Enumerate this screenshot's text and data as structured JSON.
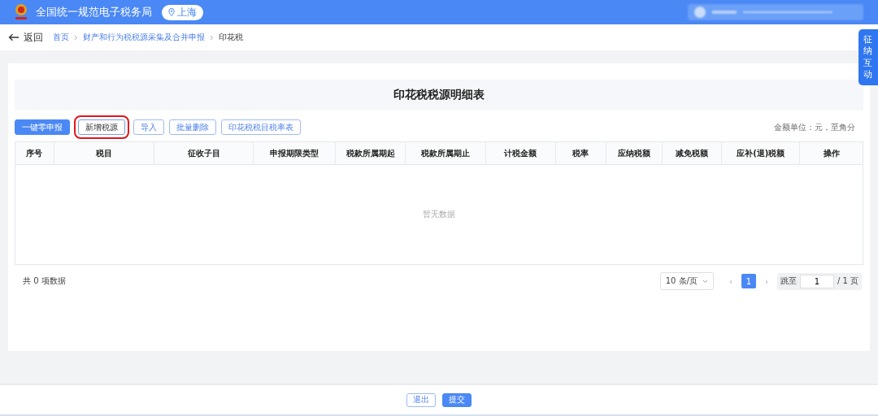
{
  "header": {
    "title": "全国统一规范电子税务局",
    "region": "上海"
  },
  "side_tab": {
    "label": "征纳互动"
  },
  "nav": {
    "back": "返回",
    "breadcrumb": [
      {
        "label": "首页",
        "link": true
      },
      {
        "label": "财产和行为税税源采集及合并申报",
        "link": true
      },
      {
        "label": "印花税",
        "link": false
      }
    ]
  },
  "page_title": "印花税税源明细表",
  "toolbar": [
    {
      "label": "一键零申报",
      "kind": "primary",
      "highlighted": false
    },
    {
      "label": "新增税源",
      "kind": "outline",
      "highlighted": true
    },
    {
      "label": "导入",
      "kind": "outline",
      "highlighted": false
    },
    {
      "label": "批量删除",
      "kind": "outline",
      "highlighted": false
    },
    {
      "label": "印花税税目税率表",
      "kind": "outline",
      "highlighted": false
    }
  ],
  "unit_note": "金额单位：元，至角分",
  "table": {
    "columns": [
      {
        "label": "序号"
      },
      {
        "label": "税目"
      },
      {
        "label": "征收子目"
      },
      {
        "label": "申报期限类型"
      },
      {
        "label": "税款所属期起"
      },
      {
        "label": "税款所属期止"
      },
      {
        "label": "计税金额"
      },
      {
        "label": "税率"
      },
      {
        "label": "应纳税额"
      },
      {
        "label": "减免税额"
      },
      {
        "label": "应补(退)税额"
      },
      {
        "label": "操作"
      }
    ],
    "empty_text": "暂无数据"
  },
  "pagination": {
    "total": "共 0 项数据",
    "page_size": "10 条/页",
    "prev": "‹",
    "pages": [
      {
        "label": "1",
        "selected": true
      }
    ],
    "next": "›",
    "jump_label": "跳至",
    "jump_value": "1",
    "page_count": "/ 1 页"
  },
  "footer_buttons": [
    {
      "label": "退出",
      "kind": "outline"
    },
    {
      "label": "提交",
      "kind": "primary"
    }
  ]
}
